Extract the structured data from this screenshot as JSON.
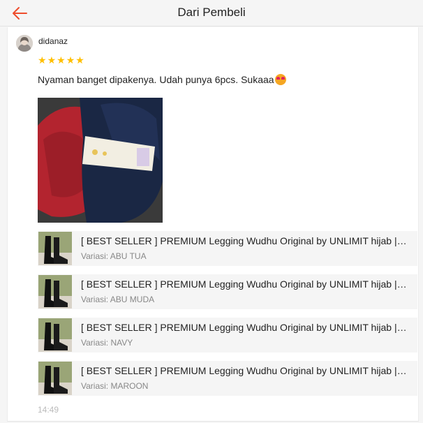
{
  "header": {
    "title": "Dari Pembeli",
    "back_icon": "arrow-left-icon",
    "accent_color": "#ee4d2d"
  },
  "review": {
    "username": "didanaz",
    "rating": 5,
    "rating_max": 5,
    "star_color": "#ffbf00",
    "text": "Nyaman banget dipakenya. Udah punya 6pcs. Sukaaa",
    "emoji_icon": "star-struck-emoji-icon",
    "timestamp": "14:49"
  },
  "products": [
    {
      "name": "[ BEST SELLER ] PREMIUM Legging Wudhu Original by UNLIMIT hijab | Legging",
      "variant": "Variasi: ABU TUA"
    },
    {
      "name": "[ BEST SELLER ] PREMIUM Legging Wudhu Original by UNLIMIT hijab | Legging",
      "variant": "Variasi: ABU MUDA"
    },
    {
      "name": "[ BEST SELLER ] PREMIUM Legging Wudhu Original by UNLIMIT hijab | Legging",
      "variant": "Variasi: NAVY"
    },
    {
      "name": "[ BEST SELLER ] PREMIUM Legging Wudhu Original by UNLIMIT hijab | Legging",
      "variant": "Variasi: MAROON"
    }
  ]
}
